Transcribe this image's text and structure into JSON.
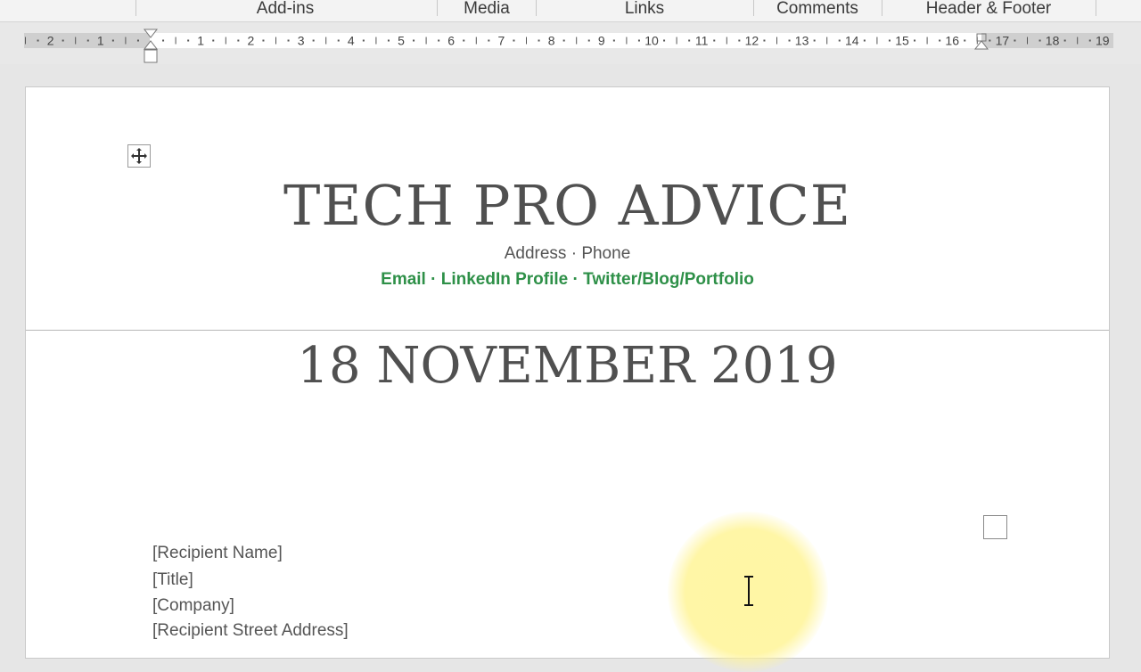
{
  "ribbon": {
    "groups": [
      {
        "label": "Add-ins"
      },
      {
        "label": "Media"
      },
      {
        "label": "Links"
      },
      {
        "label": "Comments"
      },
      {
        "label": "Header & Footer"
      }
    ]
  },
  "ruler": {
    "labels": [
      "2",
      "1",
      "1",
      "2",
      "3",
      "4",
      "5",
      "6",
      "7",
      "8",
      "9",
      "10",
      "11",
      "12",
      "13",
      "14",
      "15",
      "16",
      "17",
      "18",
      "19"
    ]
  },
  "document": {
    "company": "TECH PRO ADVICE",
    "contact_line1": "Address · Phone",
    "contact_line2": "Email · LinkedIn Profile · Twitter/Blog/Portfolio",
    "date": "18 NOVEMBER 2019",
    "recipient_name": "[Recipient Name]",
    "title": "[Title]",
    "company_placeholder": "[Company]",
    "street_address": "[Recipient Street Address]"
  },
  "colors": {
    "accent_green": "#2e9048",
    "text_gray": "#505050"
  },
  "icons": {
    "move_handle": "table-move-handle-icon",
    "cursor": "text-cursor-icon"
  }
}
